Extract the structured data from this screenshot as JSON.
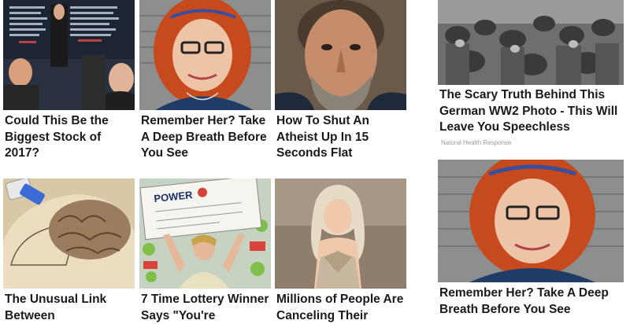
{
  "grid": [
    {
      "title": "Could This Be the Biggest Stock of 2017?",
      "image": "stock-trader-celebrating-photo"
    },
    {
      "title": "Remember Her? Take A Deep Breath Before You See",
      "image": "red-haired-woman-glasses-photo"
    },
    {
      "title": "How To Shut An Atheist Up In 15 Seconds Flat",
      "image": "bearded-old-man-portrait-photo"
    },
    {
      "title": "The Unusual Link Between",
      "image": "brain-illustration-photo"
    },
    {
      "title": "7 Time Lottery Winner Says \"You're",
      "image": "powerball-check-winner-photo"
    },
    {
      "title": "Millions of People Are Canceling Their",
      "image": "blonde-woman-costume-photo"
    }
  ],
  "sidebar": [
    {
      "title": "The Scary Truth Behind This German WW2 Photo - This Will Leave You Speechless",
      "source": "Natural Health Response",
      "image": "ww2-soldiers-helmets-photo"
    },
    {
      "title": "Remember Her? Take A Deep Breath Before You See",
      "image": "red-haired-woman-glasses-photo"
    }
  ]
}
